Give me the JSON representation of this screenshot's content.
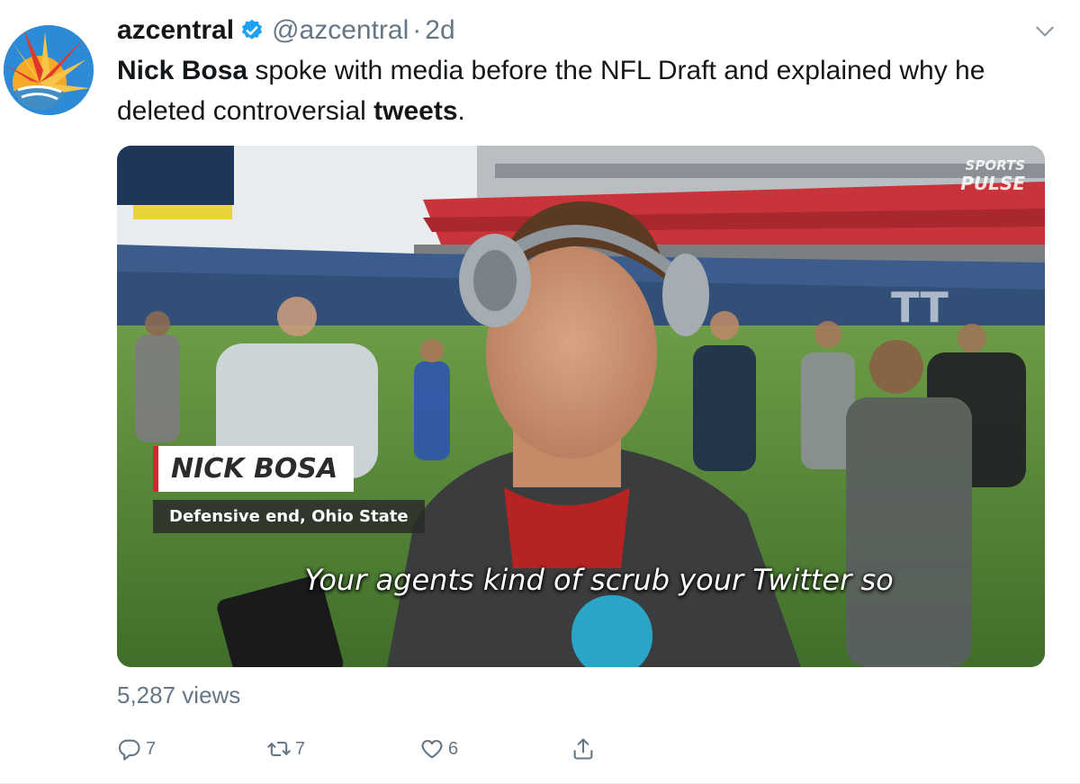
{
  "tweet": {
    "author": {
      "display_name": "azcentral",
      "handle": "@azcentral",
      "separator": "·",
      "time": "2d",
      "verified": true,
      "avatar_icon": "sun-logo-icon"
    },
    "text": {
      "bold_1": "Nick Bosa",
      "part_1": " spoke with media before the NFL Draft and explained why he deleted controversial ",
      "bold_2": "tweets",
      "part_2": "."
    },
    "media": {
      "type": "video",
      "watermark_line_1": "SPORTS",
      "watermark_line_2": "PULSE",
      "lower_third_name": "NICK BOSA",
      "lower_third_role": "Defensive end, Ohio State",
      "subtitle": "Your agents kind of scrub your Twitter so"
    },
    "views": "5,287 views",
    "actions": {
      "reply_count": "7",
      "retweet_count": "7",
      "like_count": "6",
      "reply_icon": "reply-icon",
      "retweet_icon": "retweet-icon",
      "like_icon": "heart-icon",
      "share_icon": "share-icon"
    }
  },
  "colors": {
    "text_primary": "#14171a",
    "text_secondary": "#657786",
    "verified_blue": "#1da1f2",
    "lower_third_accent": "#d7262e"
  }
}
